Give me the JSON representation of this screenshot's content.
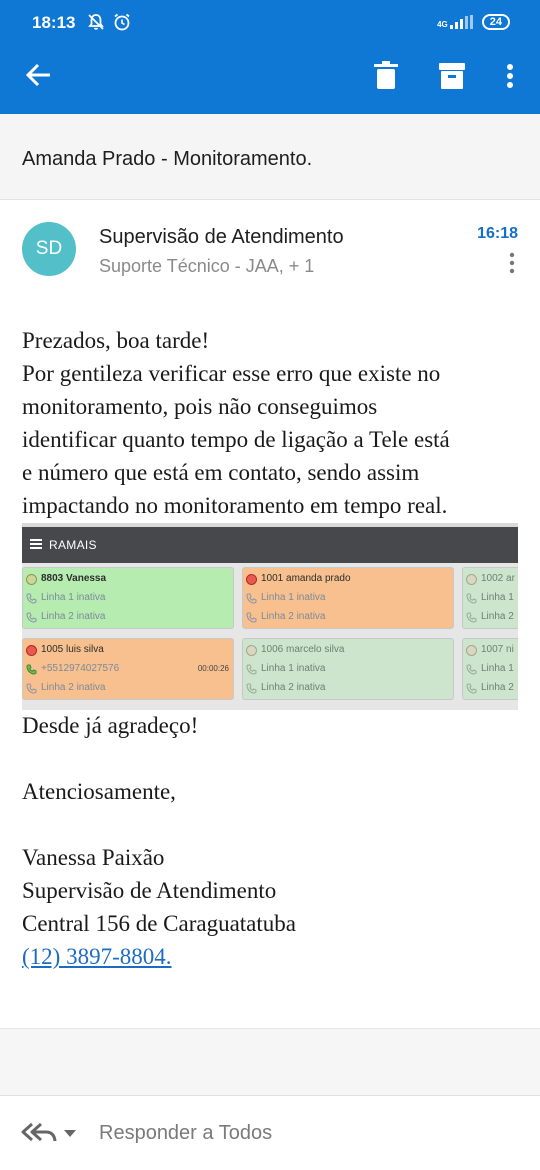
{
  "status": {
    "time": "18:13",
    "network": "4G",
    "battery": "24"
  },
  "toolbar": {
    "back_icon": "arrow-back-icon",
    "delete_icon": "trash-icon",
    "archive_icon": "archive-icon",
    "more_icon": "more-vert-icon",
    "bar_color": "#0f78d4"
  },
  "subject": "Amanda Prado - Monitoramento.",
  "sender": {
    "initials": "SD",
    "name": "Supervisão de Atendimento",
    "recipients": "Suporte Técnico - JAA, + 1",
    "time": "16:18",
    "avatar_color": "#53bfc9"
  },
  "body": {
    "greeting": "Prezados, boa tarde!",
    "paragraph_lines": [
      "Por gentileza verificar esse erro que existe no",
      "monitoramento, pois não conseguimos",
      "identificar quanto tempo de ligação a Tele está",
      "e número que está em contato, sendo assim",
      "impactando no monitoramento em tempo real."
    ],
    "thanks": "Desde já agradeço!",
    "closing": "Atenciosamente,",
    "signature_name": "Vanessa Paixão",
    "signature_role": "Supervisão de Atendimento",
    "signature_org": "Central 156 de Caraguatatuba",
    "signature_phone": "(12) 3897-8804."
  },
  "screenshot": {
    "title": "RAMAIS",
    "cards": [
      {
        "name": "8803 Vanessa",
        "status": "available",
        "line1": "Linha 1 inativa",
        "line2": "Linha 2 inativa"
      },
      {
        "name": "1001 amanda prado",
        "status": "busy",
        "line1": "Linha 1 inativa",
        "line2": "Linha 2 inativa"
      },
      {
        "name": "1002 ar",
        "status": "offline",
        "line1": "Linha 1",
        "line2": "Linha 2"
      },
      {
        "name": "1005 luis silva",
        "status": "busy",
        "line1": "+5512974027576",
        "duration": "00:00:26",
        "line2": "Linha 2 inativa"
      },
      {
        "name": "1006 marcelo silva",
        "status": "offline",
        "line1": "Linha 1 inativa",
        "line2": "Linha 2 inativa"
      },
      {
        "name": "1007 ni",
        "status": "offline",
        "line1": "Linha 1",
        "line2": "Linha 2"
      }
    ]
  },
  "reply": {
    "label": "Responder a Todos",
    "icon": "reply-all-icon"
  }
}
